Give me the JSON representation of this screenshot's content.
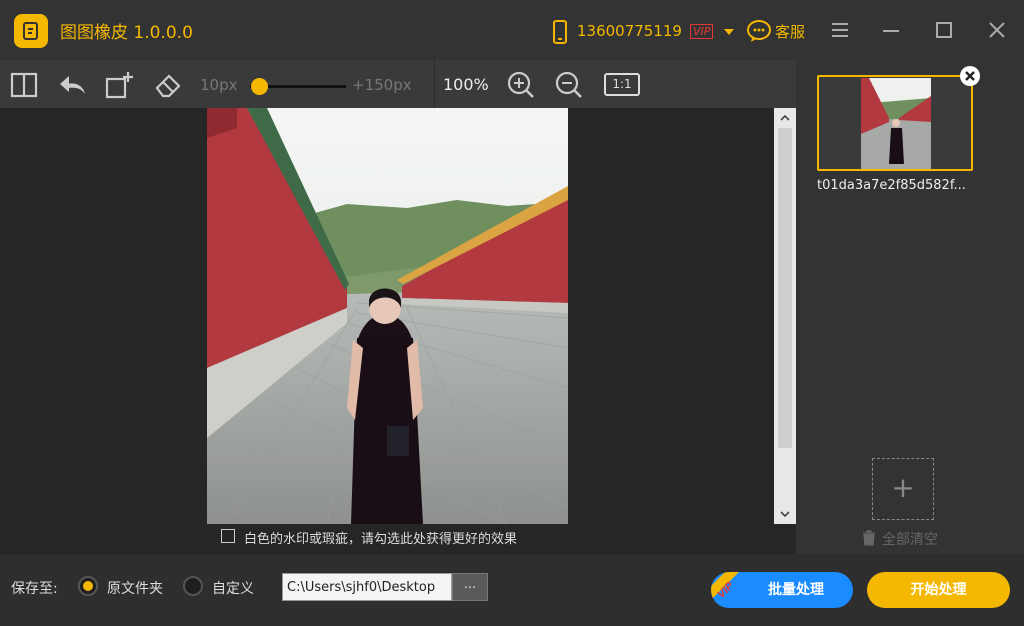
{
  "titlebar": {
    "app_name": "图图橡皮 1.0.0.0",
    "phone": "13600775119",
    "vip": "VIP",
    "service": "客服"
  },
  "toolbar": {
    "slider_min": "10px",
    "slider_max": "+150px",
    "brush_level": 0.1,
    "zoom": "100%",
    "one_to_one": "1:1"
  },
  "canvas": {
    "watermark_hint": "白色的水印或瑕疵，请勾选此处获得更好的效果",
    "watermark_checked": false
  },
  "file_panel": {
    "files": [
      {
        "name": "t01da3a7e2f85d582f..."
      }
    ],
    "clear_all": "全部清空"
  },
  "bottombar": {
    "save_to": "保存至:",
    "original_folder": "原文件夹",
    "custom": "自定义",
    "selected": "original_folder",
    "path": "C:\\Users\\sjhf0\\Desktop",
    "browse": "...",
    "batch": "批量处理",
    "batch_vip": "VIP",
    "start": "开始处理"
  },
  "colors": {
    "accent": "#f5b800",
    "batch_blue": "#1a8cff",
    "vip_red": "#e53935"
  }
}
